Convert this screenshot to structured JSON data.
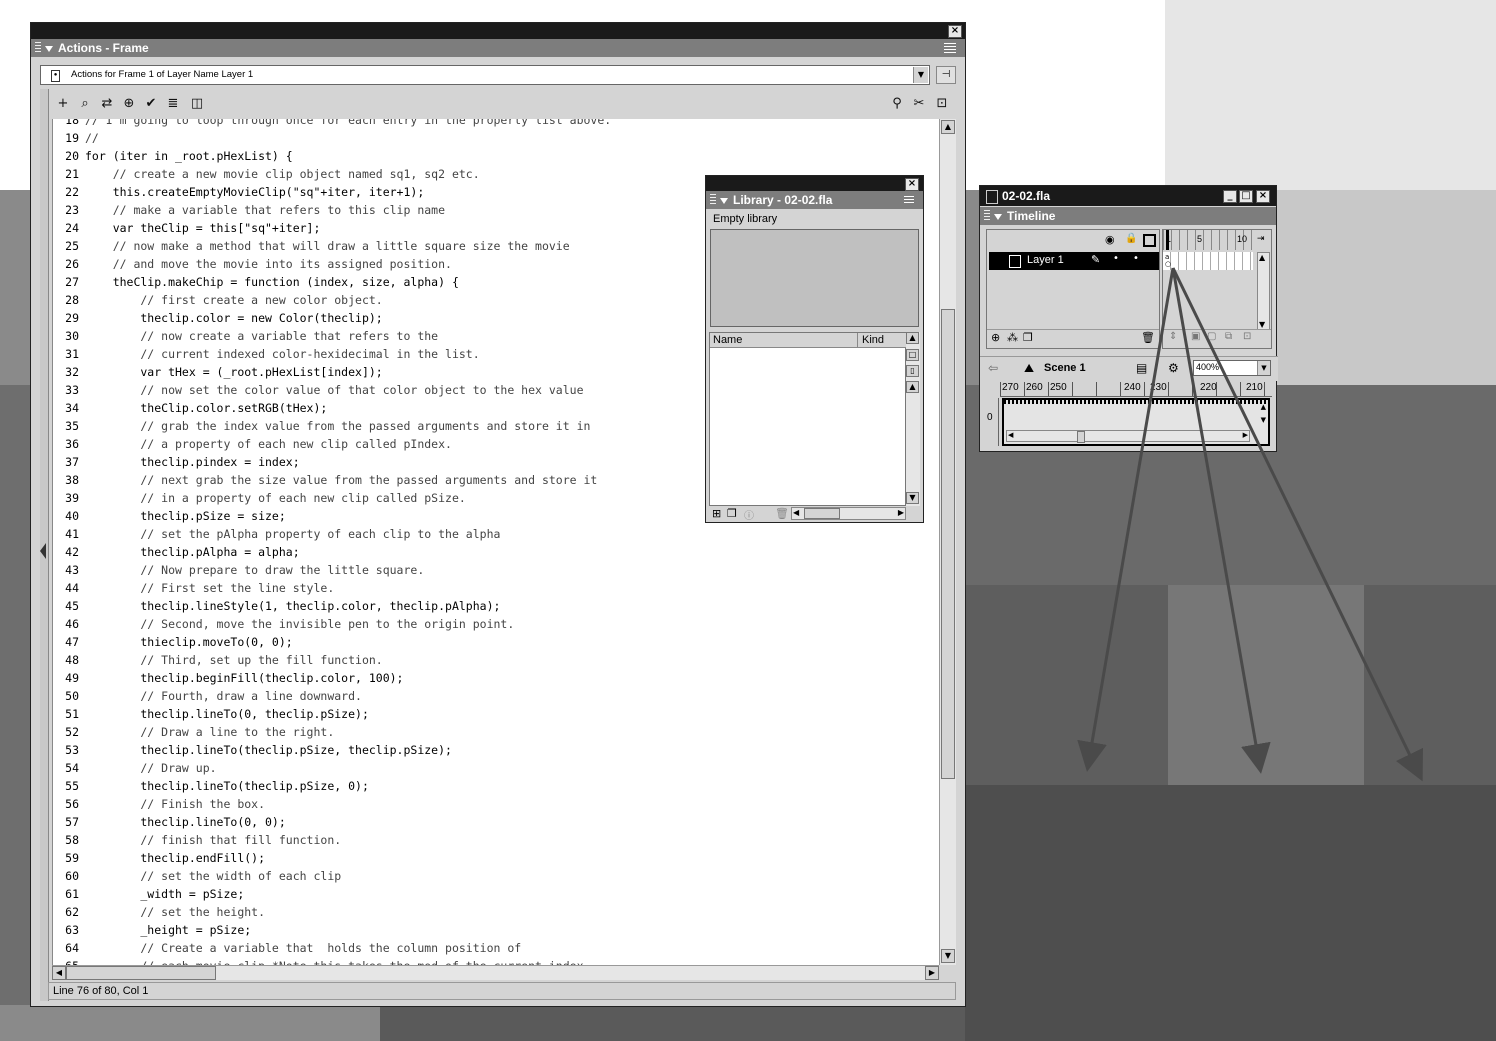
{
  "actions_panel": {
    "title": "Actions - Frame",
    "target_selector": "Actions for Frame 1 of Layer Name Layer 1",
    "status": "Line 76 of 80, Col 1",
    "code_lines": [
      {
        "n": "18",
        "t": "// I'm going to loop through once for each entry in the property list above.",
        "c": true
      },
      {
        "n": "19",
        "t": "//",
        "c": true
      },
      {
        "n": "20",
        "t": "for (iter in _root.pHexList) {",
        "c": false
      },
      {
        "n": "21",
        "t": "    // create a new movie clip object named sq1, sq2 etc.",
        "c": true
      },
      {
        "n": "22",
        "t": "    this.createEmptyMovieClip(\"sq\"+iter, iter+1);",
        "c": false
      },
      {
        "n": "23",
        "t": "    // make a variable that refers to this clip name",
        "c": true
      },
      {
        "n": "24",
        "t": "    var theClip = this[\"sq\"+iter];",
        "c": false
      },
      {
        "n": "25",
        "t": "    // now make a method that will draw a little square size the movie",
        "c": true
      },
      {
        "n": "26",
        "t": "    // and move the movie into its assigned position.",
        "c": true
      },
      {
        "n": "27",
        "t": "    theClip.makeChip = function (index, size, alpha) {",
        "c": false
      },
      {
        "n": "28",
        "t": "        // first create a new color object.",
        "c": true
      },
      {
        "n": "29",
        "t": "        theclip.color = new Color(theclip);",
        "c": false
      },
      {
        "n": "30",
        "t": "        // now create a variable that refers to the",
        "c": true
      },
      {
        "n": "31",
        "t": "        // current indexed color-hexidecimal in the list.",
        "c": true
      },
      {
        "n": "32",
        "t": "        var tHex = (_root.pHexList[index]);",
        "c": false
      },
      {
        "n": "33",
        "t": "        // now set the color value of that color object to the hex value",
        "c": true
      },
      {
        "n": "34",
        "t": "        theClip.color.setRGB(tHex);",
        "c": false
      },
      {
        "n": "35",
        "t": "        // grab the index value from the passed arguments and store it in",
        "c": true
      },
      {
        "n": "36",
        "t": "        // a property of each new clip called pIndex.",
        "c": true
      },
      {
        "n": "37",
        "t": "        theclip.pindex = index;",
        "c": false
      },
      {
        "n": "38",
        "t": "        // next grab the size value from the passed arguments and store it",
        "c": true
      },
      {
        "n": "39",
        "t": "        // in a property of each new clip called pSize.",
        "c": true
      },
      {
        "n": "40",
        "t": "        theclip.pSize = size;",
        "c": false
      },
      {
        "n": "41",
        "t": "        // set the pAlpha property of each clip to the alpha",
        "c": true
      },
      {
        "n": "42",
        "t": "        theclip.pAlpha = alpha;",
        "c": false
      },
      {
        "n": "43",
        "t": "        // Now prepare to draw the little square.",
        "c": true
      },
      {
        "n": "44",
        "t": "        // First set the line style.",
        "c": true
      },
      {
        "n": "45",
        "t": "        theclip.lineStyle(1, theclip.color, theclip.pAlpha);",
        "c": false
      },
      {
        "n": "46",
        "t": "        // Second, move the invisible pen to the origin point.",
        "c": true
      },
      {
        "n": "47",
        "t": "        thieclip.moveTo(0, 0);",
        "c": false
      },
      {
        "n": "48",
        "t": "        // Third, set up the fill function.",
        "c": true
      },
      {
        "n": "49",
        "t": "        theclip.beginFill(theclip.color, 100);",
        "c": false
      },
      {
        "n": "50",
        "t": "        // Fourth, draw a line downward.",
        "c": true
      },
      {
        "n": "51",
        "t": "        theclip.lineTo(0, theclip.pSize);",
        "c": false
      },
      {
        "n": "52",
        "t": "        // Draw a line to the right.",
        "c": true
      },
      {
        "n": "53",
        "t": "        theclip.lineTo(theclip.pSize, theclip.pSize);",
        "c": false
      },
      {
        "n": "54",
        "t": "        // Draw up.",
        "c": true
      },
      {
        "n": "55",
        "t": "        theclip.lineTo(theclip.pSize, 0);",
        "c": false
      },
      {
        "n": "56",
        "t": "        // Finish the box.",
        "c": true
      },
      {
        "n": "57",
        "t": "        theclip.lineTo(0, 0);",
        "c": false
      },
      {
        "n": "58",
        "t": "        // finish that fill function.",
        "c": true
      },
      {
        "n": "59",
        "t": "        theclip.endFill();",
        "c": false
      },
      {
        "n": "60",
        "t": "        // set the width of each clip",
        "c": true
      },
      {
        "n": "61",
        "t": "        _width = pSize;",
        "c": false
      },
      {
        "n": "62",
        "t": "        // set the height.",
        "c": true
      },
      {
        "n": "63",
        "t": "        _height = pSize;",
        "c": false
      },
      {
        "n": "64",
        "t": "        // Create a variable that  holds the column position of",
        "c": true
      },
      {
        "n": "65",
        "t": "        // each movie clip *Note this takes the mod of the current index",
        "c": true
      }
    ]
  },
  "library_panel": {
    "title": "Library - 02-02.fla",
    "status": "Empty library",
    "col_name": "Name",
    "col_kind": "Kind"
  },
  "timeline_window": {
    "doc_title": "02-02.fla",
    "panel_title": "Timeline",
    "layer_name": "Layer 1",
    "frame_ticks": [
      "1",
      "5",
      "10"
    ],
    "scene": "Scene 1",
    "zoom": "400%",
    "ruler": [
      "270",
      "260",
      "250",
      "240",
      "230",
      "220",
      "210"
    ],
    "vruler": "0"
  },
  "colors": {
    "titlebar": "#1a1a1a",
    "panel": "#d4d4d4",
    "header": "#7d7d7d",
    "arrow": "#4a4a4a"
  }
}
